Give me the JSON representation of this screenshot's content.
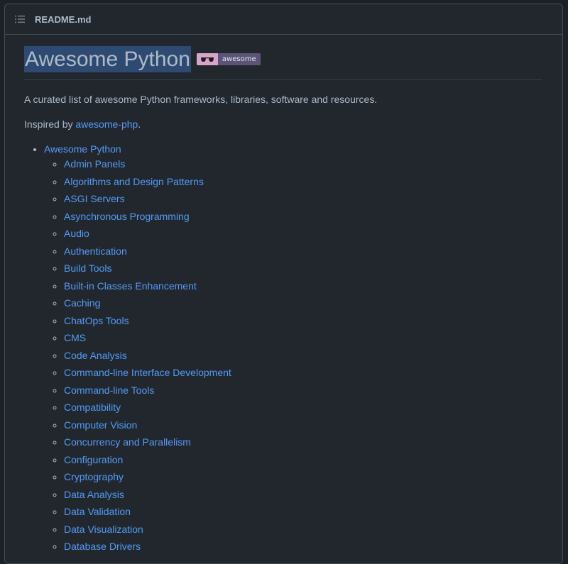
{
  "header": {
    "file_name": "README.md",
    "list_icon": "list-unordered-icon"
  },
  "readme": {
    "title": "Awesome Python",
    "badge": {
      "icon": "sunglasses-icon",
      "label": "awesome"
    },
    "description": "A curated list of awesome Python frameworks, libraries, software and resources.",
    "inspired_prefix": "Inspired by ",
    "inspired_link": "awesome-php",
    "inspired_suffix": ".",
    "toc_title": "Awesome Python",
    "toc_items": [
      "Admin Panels",
      "Algorithms and Design Patterns",
      "ASGI Servers",
      "Asynchronous Programming",
      "Audio",
      "Authentication",
      "Build Tools",
      "Built-in Classes Enhancement",
      "Caching",
      "ChatOps Tools",
      "CMS",
      "Code Analysis",
      "Command-line Interface Development",
      "Command-line Tools",
      "Compatibility",
      "Computer Vision",
      "Concurrency and Parallelism",
      "Configuration",
      "Cryptography",
      "Data Analysis",
      "Data Validation",
      "Data Visualization",
      "Database Drivers"
    ]
  },
  "colors": {
    "background": "#22272e",
    "border": "#444c56",
    "text": "#adbac7",
    "link": "#539bf5",
    "selection": "#2f4a72"
  }
}
